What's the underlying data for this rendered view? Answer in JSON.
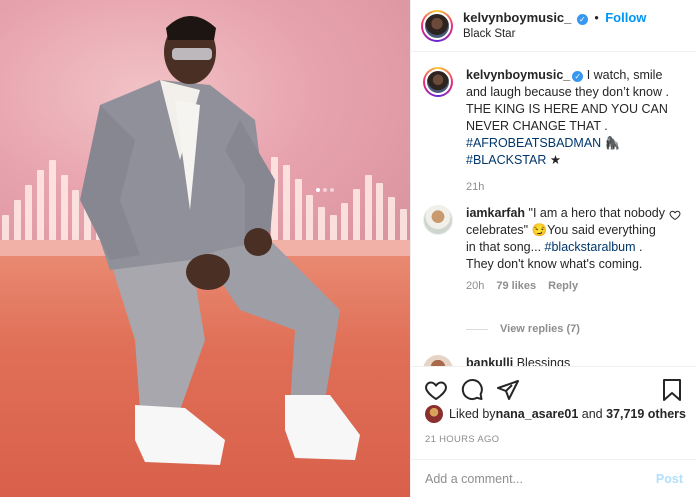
{
  "header": {
    "username": "kelvynboymusic_",
    "verified_glyph": "✓",
    "separator": "•",
    "follow_label": "Follow",
    "location": "Black Star"
  },
  "caption": {
    "username": "kelvynboymusic_",
    "text": " I watch, smile and laugh because they don’t know . THE KING IS HERE AND YOU CAN NEVER CHANGE THAT . ",
    "hashtag1": "#AFROBEATSBADMAN",
    "emoji1": "🦍",
    "hashtag2": "#BLACKSTAR",
    "emoji2": "★",
    "time": "21h"
  },
  "comment1": {
    "username": "iamkarfah",
    "text_before": " \"I am a hero that nobody celebrates\" ",
    "emoji": "😏",
    "text_middle": "You said everything in that song... ",
    "hashtag": "#blackstaralbum",
    "text_after": " . They don't know what's coming.",
    "time": "20h",
    "likes": "79 likes",
    "reply": "Reply",
    "view_replies": "View replies (7)"
  },
  "comment2": {
    "username": "bankulli",
    "text": " Blessings"
  },
  "likes": {
    "prefix": "Liked by ",
    "user": "nana_asare01",
    "middle": " and ",
    "count": "37,719 others"
  },
  "timestamp": "21 HOURS AGO",
  "add_comment": {
    "placeholder": "Add a comment...",
    "post_label": "Post"
  },
  "icons": {
    "like": "heart-icon",
    "comment": "comment-icon",
    "share": "share-icon",
    "save": "bookmark-icon"
  },
  "colors": {
    "link": "#0095f6",
    "tag": "#00376b",
    "muted": "#8e8e8e",
    "verified": "#3897f0"
  }
}
